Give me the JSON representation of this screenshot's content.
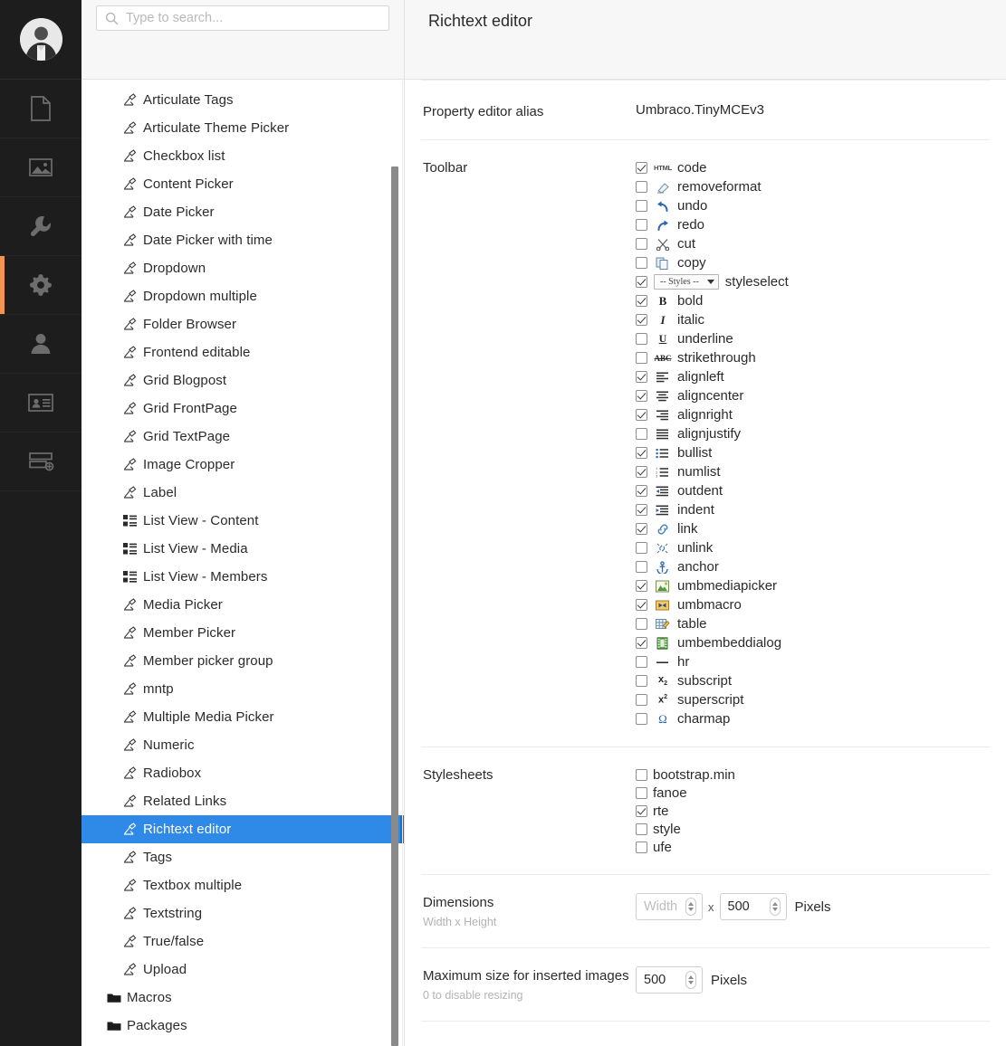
{
  "app": {
    "accent_orange": "#f09553",
    "selection_blue": "#2e8ae6"
  },
  "rail": {
    "avatar_name": "user-avatar",
    "items": [
      {
        "name": "content",
        "icon": "document-icon"
      },
      {
        "name": "media",
        "icon": "image-icon"
      },
      {
        "name": "settings",
        "icon": "wrench-icon"
      },
      {
        "name": "developer",
        "icon": "gear-icon",
        "active": true
      },
      {
        "name": "users",
        "icon": "person-icon"
      },
      {
        "name": "members",
        "icon": "id-card-icon"
      },
      {
        "name": "forms",
        "icon": "forms-icon"
      }
    ]
  },
  "search": {
    "placeholder": "Type to search...",
    "value": ""
  },
  "tree": {
    "items": [
      {
        "label": "Articulate Tags",
        "icon": "datatype-icon",
        "level": 1
      },
      {
        "label": "Articulate Theme Picker",
        "icon": "datatype-icon",
        "level": 1
      },
      {
        "label": "Checkbox list",
        "icon": "datatype-icon",
        "level": 1
      },
      {
        "label": "Content Picker",
        "icon": "datatype-icon",
        "level": 1
      },
      {
        "label": "Date Picker",
        "icon": "datatype-icon",
        "level": 1
      },
      {
        "label": "Date Picker with time",
        "icon": "datatype-icon",
        "level": 1
      },
      {
        "label": "Dropdown",
        "icon": "datatype-icon",
        "level": 1
      },
      {
        "label": "Dropdown multiple",
        "icon": "datatype-icon",
        "level": 1
      },
      {
        "label": "Folder Browser",
        "icon": "datatype-icon",
        "level": 1
      },
      {
        "label": "Frontend editable",
        "icon": "datatype-icon",
        "level": 1
      },
      {
        "label": "Grid Blogpost",
        "icon": "datatype-icon",
        "level": 1
      },
      {
        "label": "Grid FrontPage",
        "icon": "datatype-icon",
        "level": 1
      },
      {
        "label": "Grid TextPage",
        "icon": "datatype-icon",
        "level": 1
      },
      {
        "label": "Image Cropper",
        "icon": "datatype-icon",
        "level": 1
      },
      {
        "label": "Label",
        "icon": "datatype-icon",
        "level": 1
      },
      {
        "label": "List View - Content",
        "icon": "listview-icon",
        "level": 1
      },
      {
        "label": "List View - Media",
        "icon": "listview-icon",
        "level": 1
      },
      {
        "label": "List View - Members",
        "icon": "listview-icon",
        "level": 1
      },
      {
        "label": "Media Picker",
        "icon": "datatype-icon",
        "level": 1
      },
      {
        "label": "Member Picker",
        "icon": "datatype-icon",
        "level": 1
      },
      {
        "label": "Member picker group",
        "icon": "datatype-icon",
        "level": 1
      },
      {
        "label": "mntp",
        "icon": "datatype-icon",
        "level": 1
      },
      {
        "label": "Multiple Media Picker",
        "icon": "datatype-icon",
        "level": 1
      },
      {
        "label": "Numeric",
        "icon": "datatype-icon",
        "level": 1
      },
      {
        "label": "Radiobox",
        "icon": "datatype-icon",
        "level": 1
      },
      {
        "label": "Related Links",
        "icon": "datatype-icon",
        "level": 1
      },
      {
        "label": "Richtext editor",
        "icon": "datatype-icon",
        "level": 1,
        "selected": true
      },
      {
        "label": "Tags",
        "icon": "datatype-icon",
        "level": 1
      },
      {
        "label": "Textbox multiple",
        "icon": "datatype-icon",
        "level": 1
      },
      {
        "label": "Textstring",
        "icon": "datatype-icon",
        "level": 1
      },
      {
        "label": "True/false",
        "icon": "datatype-icon",
        "level": 1
      },
      {
        "label": "Upload",
        "icon": "datatype-icon",
        "level": 1
      },
      {
        "label": "Macros",
        "icon": "folder-icon",
        "level": 0
      },
      {
        "label": "Packages",
        "icon": "folder-icon",
        "level": 0
      }
    ]
  },
  "header": {
    "title": "Richtext editor"
  },
  "properties": {
    "alias": {
      "label": "Property editor alias",
      "value": "Umbraco.TinyMCEv3"
    },
    "toolbar": {
      "label": "Toolbar",
      "items": [
        {
          "label": "code",
          "checked": true,
          "icon": "html-icon"
        },
        {
          "label": "removeformat",
          "checked": false,
          "icon": "eraser-icon"
        },
        {
          "label": "undo",
          "checked": false,
          "icon": "undo-icon"
        },
        {
          "label": "redo",
          "checked": false,
          "icon": "redo-icon"
        },
        {
          "label": "cut",
          "checked": false,
          "icon": "scissors-icon"
        },
        {
          "label": "copy",
          "checked": false,
          "icon": "copy-icon"
        },
        {
          "label": "styleselect",
          "checked": true,
          "icon": "styles-dropdown",
          "dropdown_label": "-- Styles --"
        },
        {
          "label": "bold",
          "checked": true,
          "icon": "bold-icon"
        },
        {
          "label": "italic",
          "checked": true,
          "icon": "italic-icon"
        },
        {
          "label": "underline",
          "checked": false,
          "icon": "underline-icon"
        },
        {
          "label": "strikethrough",
          "checked": false,
          "icon": "strikethrough-icon"
        },
        {
          "label": "alignleft",
          "checked": true,
          "icon": "align-left-icon"
        },
        {
          "label": "aligncenter",
          "checked": true,
          "icon": "align-center-icon"
        },
        {
          "label": "alignright",
          "checked": true,
          "icon": "align-right-icon"
        },
        {
          "label": "alignjustify",
          "checked": false,
          "icon": "align-justify-icon"
        },
        {
          "label": "bullist",
          "checked": true,
          "icon": "bullet-list-icon"
        },
        {
          "label": "numlist",
          "checked": true,
          "icon": "numbered-list-icon"
        },
        {
          "label": "outdent",
          "checked": true,
          "icon": "outdent-icon"
        },
        {
          "label": "indent",
          "checked": true,
          "icon": "indent-icon"
        },
        {
          "label": "link",
          "checked": true,
          "icon": "link-icon"
        },
        {
          "label": "unlink",
          "checked": false,
          "icon": "unlink-icon"
        },
        {
          "label": "anchor",
          "checked": false,
          "icon": "anchor-icon"
        },
        {
          "label": "umbmediapicker",
          "checked": true,
          "icon": "media-picker-icon"
        },
        {
          "label": "umbmacro",
          "checked": true,
          "icon": "macro-icon"
        },
        {
          "label": "table",
          "checked": false,
          "icon": "table-icon"
        },
        {
          "label": "umbembeddialog",
          "checked": true,
          "icon": "embed-icon"
        },
        {
          "label": "hr",
          "checked": false,
          "icon": "horizontal-rule-icon"
        },
        {
          "label": "subscript",
          "checked": false,
          "icon": "subscript-icon"
        },
        {
          "label": "superscript",
          "checked": false,
          "icon": "superscript-icon"
        },
        {
          "label": "charmap",
          "checked": false,
          "icon": "charmap-icon"
        }
      ]
    },
    "stylesheets": {
      "label": "Stylesheets",
      "items": [
        {
          "label": "bootstrap.min",
          "checked": false
        },
        {
          "label": "fanoe",
          "checked": false
        },
        {
          "label": "rte",
          "checked": true
        },
        {
          "label": "style",
          "checked": false
        },
        {
          "label": "ufe",
          "checked": false
        }
      ]
    },
    "dimensions": {
      "label": "Dimensions",
      "description": "Width x Height",
      "width_value": "",
      "width_placeholder": "Width",
      "separator": "x",
      "height_value": "500",
      "unit": "Pixels"
    },
    "max_size": {
      "label": "Maximum size for inserted images",
      "description": "0 to disable resizing",
      "value": "500",
      "unit": "Pixels"
    }
  }
}
